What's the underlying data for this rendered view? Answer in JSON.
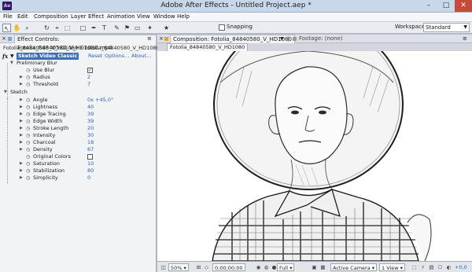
{
  "window": {
    "title": "Adobe After Effects - Untitled Project.aep *",
    "app_icon_text": "Ae",
    "min_glyph": "–",
    "max_glyph": "□",
    "close_glyph": "✕"
  },
  "menu": [
    "File",
    "Edit",
    "Composition",
    "Layer",
    "Effect",
    "Animation",
    "View",
    "Window",
    "Help"
  ],
  "toolbar": {
    "tools": [
      {
        "name": "selection-tool-icon",
        "glyph": "↖"
      },
      {
        "name": "hand-tool-icon",
        "glyph": "✋"
      },
      {
        "name": "zoom-tool-icon",
        "glyph": "⌕"
      },
      {
        "name": "rotate-tool-icon",
        "glyph": "↻"
      },
      {
        "name": "camera-tool-icon",
        "glyph": "⌖"
      },
      {
        "name": "pan-behind-tool-icon",
        "glyph": "⬚"
      },
      {
        "name": "rectangle-tool-icon",
        "glyph": "□"
      },
      {
        "name": "pen-tool-icon",
        "glyph": "✒"
      },
      {
        "name": "type-tool-icon",
        "glyph": "T"
      },
      {
        "name": "brush-tool-icon",
        "glyph": "✎"
      },
      {
        "name": "clone-stamp-tool-icon",
        "glyph": "⚑"
      },
      {
        "name": "eraser-tool-icon",
        "glyph": "▭"
      },
      {
        "name": "roto-brush-tool-icon",
        "glyph": "✦"
      },
      {
        "name": "puppet-tool-icon",
        "glyph": "★"
      }
    ],
    "snapping_label": "Snapping",
    "workspace_label": "Workspace:",
    "workspace_value": "Standard"
  },
  "effect_controls": {
    "tab_label": "Effect Controls: Fotolia_84840580_V_HD1080.mp4",
    "breadcrumb": "Fotolia_84840580_V_HD1080 • Fotolia_84840580_V_HD1080.mp4",
    "effect_name": "Sketch Video Classic",
    "reset": "Reset",
    "options": "Options...",
    "about": "About...",
    "preliminary_blur": "Preliminary Blur",
    "use_blur": {
      "label": "Use Blur",
      "checked": true
    },
    "radius": {
      "label": "Radius",
      "value": "2"
    },
    "threshold": {
      "label": "Threshold",
      "value": "7"
    },
    "sketch": "Sketch",
    "angle": {
      "label": "Angle",
      "value": "0x +45,0°"
    },
    "lightness": {
      "label": "Lightness",
      "value": "40"
    },
    "edge_tracing": {
      "label": "Edge Tracing",
      "value": "39"
    },
    "edge_width": {
      "label": "Edge Width",
      "value": "39"
    },
    "stroke_length": {
      "label": "Stroke Length",
      "value": "20"
    },
    "intensity": {
      "label": "Intensity",
      "value": "30"
    },
    "charcoal": {
      "label": "Charcoal",
      "value": "18"
    },
    "density": {
      "label": "Density",
      "value": "67"
    },
    "original_colors": {
      "label": "Original Colors",
      "checked": false
    },
    "saturation": {
      "label": "Saturation",
      "value": "10"
    },
    "stabilization": {
      "label": "Stabilization",
      "value": "80"
    },
    "simplicity": {
      "label": "Simplicity",
      "value": "0"
    }
  },
  "composition": {
    "tab_label": "Composition: Fotolia_84840580_V_HD1080",
    "footage_tab": "Footage: (none)",
    "sub_tab": "Fotolia_84840580_V_HD1080"
  },
  "viewer_bar": {
    "zoom": "50%",
    "timecode": "0;00;00;00",
    "resolution": "Full",
    "camera": "Active Camera",
    "views": "1 View",
    "exposure": "+0,0"
  }
}
